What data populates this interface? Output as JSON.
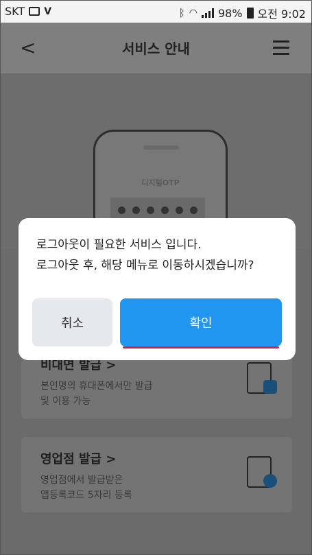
{
  "status_bar": {
    "carrier": "SKT",
    "battery": "98%",
    "time": "오전 9:02"
  },
  "header": {
    "title": "서비스 안내"
  },
  "illustration": {
    "otp_label": "디지털OTP"
  },
  "cards": [
    {
      "title": "비대면 발급 >",
      "desc": "본인명의 휴대폰에서만 발급\n및 이용 가능"
    },
    {
      "title": "영업점 발급 >",
      "desc": "영업점에서 발급받은\n앱등록코드 5자리 등록"
    }
  ],
  "dialog": {
    "line1": "로그아웃이 필요한 서비스 입니다.",
    "line2": "로그아웃 후, 해당 메뉴로 이동하시겠습니까?",
    "cancel_label": "취소",
    "confirm_label": "확인"
  },
  "colors": {
    "confirm": "#2196f0",
    "cancel": "#e5e9ee",
    "highlight": "#e0203a"
  }
}
